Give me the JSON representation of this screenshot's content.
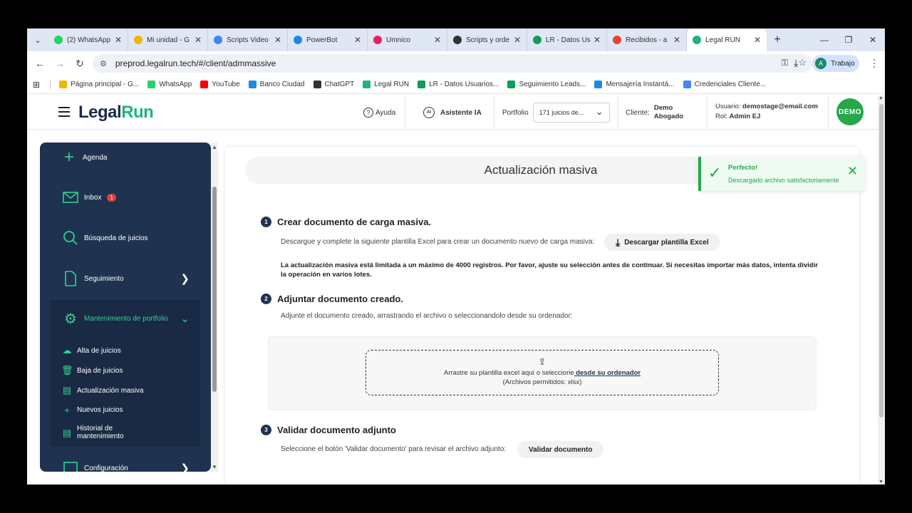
{
  "browser": {
    "tabs": [
      {
        "label": "(2) WhatsApp",
        "icon": "whatsapp-icon",
        "color": "#25d366"
      },
      {
        "label": "Mi unidad - G",
        "icon": "drive-icon",
        "color": "#f4b400"
      },
      {
        "label": "Scripts Video",
        "icon": "docs-icon",
        "color": "#4285f4"
      },
      {
        "label": "PowerBot",
        "icon": "cloud-icon",
        "color": "#1e88e5"
      },
      {
        "label": "Umnico",
        "icon": "umnico-icon",
        "color": "#e91e63"
      },
      {
        "label": "Scripts y orde",
        "icon": "openai-icon",
        "color": "#333333"
      },
      {
        "label": "LR - Datos Us",
        "icon": "sheets-icon",
        "color": "#0f9d58"
      },
      {
        "label": "Recibidos - a",
        "icon": "gmail-icon",
        "color": "#ea4335"
      },
      {
        "label": "Legal RUN",
        "icon": "legalrun-icon",
        "color": "#1fb47b"
      }
    ],
    "url": "preprod.legalrun.tech/#/client/admmassive",
    "profile": {
      "initial": "A",
      "label": "Trabajo"
    },
    "bookmarks": [
      {
        "label": "Página principal - G...",
        "color": "#f4b400"
      },
      {
        "label": "WhatsApp",
        "color": "#25d366"
      },
      {
        "label": "YouTube",
        "color": "#ff0000"
      },
      {
        "label": "Banco Ciudad",
        "color": "#1e88e5"
      },
      {
        "label": "ChatGPT",
        "color": "#333333"
      },
      {
        "label": "Legal RUN",
        "color": "#1fb47b"
      },
      {
        "label": "LR - Datos Usuarios...",
        "color": "#0f9d58"
      },
      {
        "label": "Seguimiento Leads...",
        "color": "#0f9d58"
      },
      {
        "label": "Mensajería Instantá...",
        "color": "#1e88e5"
      },
      {
        "label": "Credenciales Cliente...",
        "color": "#4285f4"
      }
    ]
  },
  "header": {
    "logo_a": "Legal",
    "logo_b": "Run",
    "help": "Ayuda",
    "assistant": "Asistente IA",
    "assistant_icon_text": "AI",
    "portfolio_label": "Portfolio",
    "portfolio_value": "171 juicios de...",
    "client_label": "Cliente:",
    "client_value_1": "Demo",
    "client_value_2": "Abogado",
    "user_label": "Usuario:",
    "user_value": "demostage@email.com",
    "role_label": "Rol:",
    "role_value": "Admin EJ",
    "badge": "DEMO"
  },
  "sidebar": {
    "agenda": "Agenda",
    "inbox": "Inbox",
    "inbox_count": "1",
    "search": "Búsqueda de juicios",
    "follow": "Seguimiento",
    "maintenance": "Mantenimiento de portfolio",
    "sub": {
      "alta": "Alta de juicios",
      "baja": "Baja de juicios",
      "actualizacion": "Actualización masiva",
      "nuevos": "Nuevos juicios",
      "historial_1": "Historial de",
      "historial_2": "mantenimiento"
    },
    "config": "Configuración"
  },
  "main": {
    "title": "Actualización masiva",
    "step1": {
      "num": "1",
      "title": "Crear documento de carga masiva.",
      "desc": "Descargue y complete la siguiente plantilla Excel para crear un documento nuevo de carga masiva:",
      "button": "Descargar plantilla Excel"
    },
    "warning": "La actualización masiva está limitada a un máximo de 4000 registros. Por favor, ajuste su selección antes de continuar. Si necesitas importar más datos, intenta dividir la operación en varios lotes.",
    "step2": {
      "num": "2",
      "title": "Adjuntar documento creado.",
      "desc": "Adjunte el documento creado, arrastrando el archivo o seleccionandolo desde su ordenador:"
    },
    "dropzone": {
      "text": "Arrastre su plantilla excel aquí o seleccione",
      "link": " desde su ordenador",
      "allowed": "(Archivos permitidos: xlsx)"
    },
    "step3": {
      "num": "3",
      "title": "Validar documento adjunto",
      "desc": "Seleccione el botón 'Validar documento' para revisar el archivo adjunto:",
      "button": "Validar documento"
    }
  },
  "toast": {
    "title": "Perfecto!",
    "message": "Descargado archivo satisfactoriamente"
  },
  "colors": {
    "accent": "#1fb47b",
    "sidebar": "#1f3350",
    "success": "#27a74a"
  }
}
